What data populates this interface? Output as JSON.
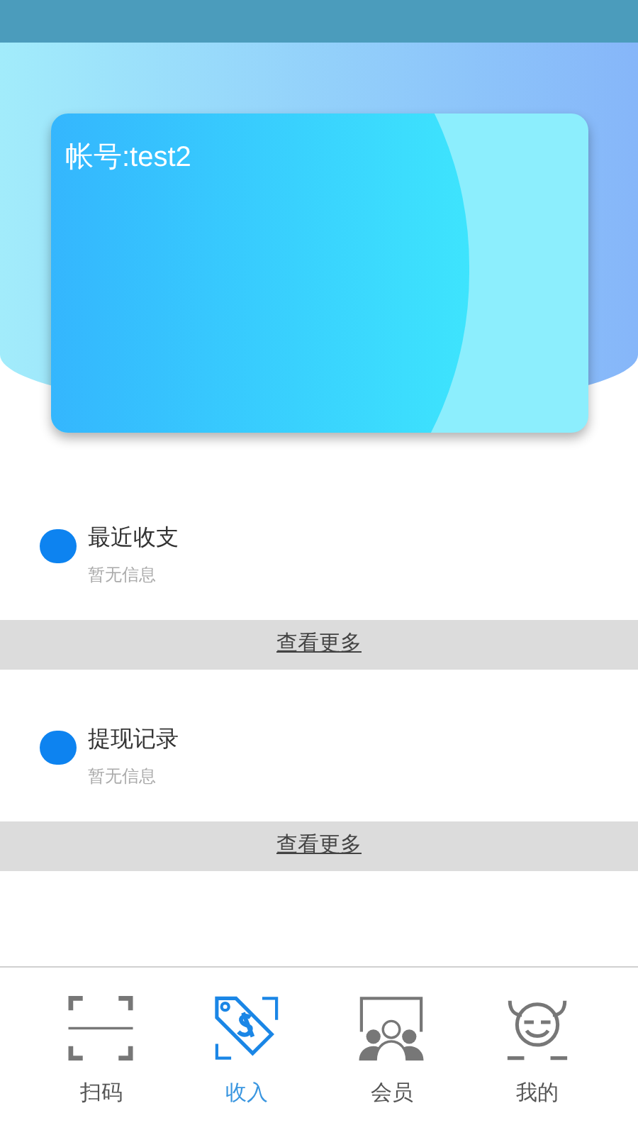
{
  "account": {
    "label": "帐号:test2"
  },
  "sections": [
    {
      "title": "最近收支",
      "empty_text": "暂无信息",
      "more_link": "查看更多"
    },
    {
      "title": "提现记录",
      "empty_text": "暂无信息",
      "more_link": "查看更多"
    }
  ],
  "tab_bar": [
    {
      "kind": "scan",
      "label": "扫码",
      "selected": false
    },
    {
      "kind": "income",
      "label": "收入",
      "selected": true
    },
    {
      "kind": "members",
      "label": "会员",
      "selected": false
    },
    {
      "kind": "me",
      "label": "我的",
      "selected": false
    }
  ]
}
